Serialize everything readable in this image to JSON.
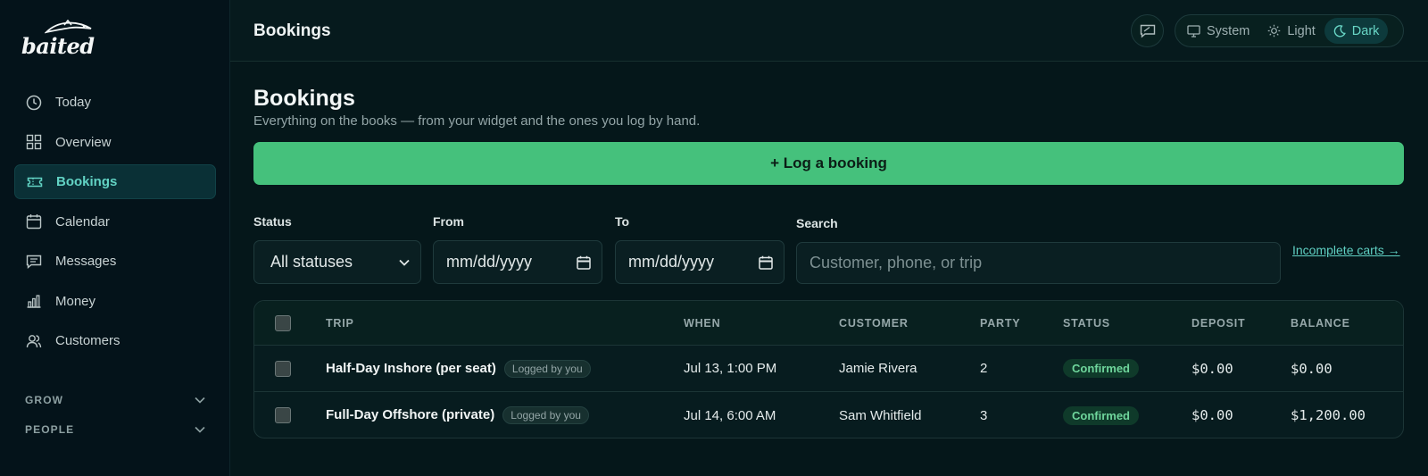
{
  "app": {
    "logo_text": "baited"
  },
  "sidebar": {
    "items": [
      {
        "label": "Today",
        "icon": "clock-icon"
      },
      {
        "label": "Overview",
        "icon": "grid-icon"
      },
      {
        "label": "Bookings",
        "icon": "ticket-icon",
        "active": true
      },
      {
        "label": "Calendar",
        "icon": "calendar-icon"
      },
      {
        "label": "Messages",
        "icon": "message-icon"
      },
      {
        "label": "Money",
        "icon": "bar-chart-icon"
      },
      {
        "label": "Customers",
        "icon": "users-icon"
      }
    ],
    "groups": [
      {
        "label": "GROW"
      },
      {
        "label": "PEOPLE"
      }
    ]
  },
  "header": {
    "title": "Bookings",
    "theme_options": [
      {
        "label": "System",
        "icon": "monitor-icon"
      },
      {
        "label": "Light",
        "icon": "sun-icon"
      },
      {
        "label": "Dark",
        "icon": "moon-icon",
        "active": true
      }
    ]
  },
  "main": {
    "title": "Bookings",
    "subtitle": "Everything on the books — from your widget and the ones you log by hand.",
    "log_button": "+ Log a booking",
    "filters": {
      "status_label": "Status",
      "status_value": "All statuses",
      "from_label": "From",
      "from_placeholder": "mm/dd/yyyy",
      "to_label": "To",
      "to_placeholder": "mm/dd/yyyy",
      "search_label": "Search",
      "search_placeholder": "Customer, phone, or trip"
    },
    "incomplete_link": "Incomplete carts →",
    "table": {
      "headers": [
        "TRIP",
        "WHEN",
        "CUSTOMER",
        "PARTY",
        "STATUS",
        "DEPOSIT",
        "BALANCE"
      ],
      "rows": [
        {
          "trip": "Half-Day Inshore (per seat)",
          "tag": "Logged by you",
          "when": "Jul 13, 1:00 PM",
          "customer": "Jamie Rivera",
          "party": "2",
          "status": "Confirmed",
          "deposit": "$0.00",
          "balance": "$0.00"
        },
        {
          "trip": "Full-Day Offshore (private)",
          "tag": "Logged by you",
          "when": "Jul 14, 6:00 AM",
          "customer": "Sam Whitfield",
          "party": "3",
          "status": "Confirmed",
          "deposit": "$0.00",
          "balance": "$1,200.00"
        }
      ]
    }
  },
  "colors": {
    "accent_teal": "#62d3c4",
    "primary_green": "#45c17c",
    "status_green": "#6fd69c",
    "background": "#05171a"
  }
}
